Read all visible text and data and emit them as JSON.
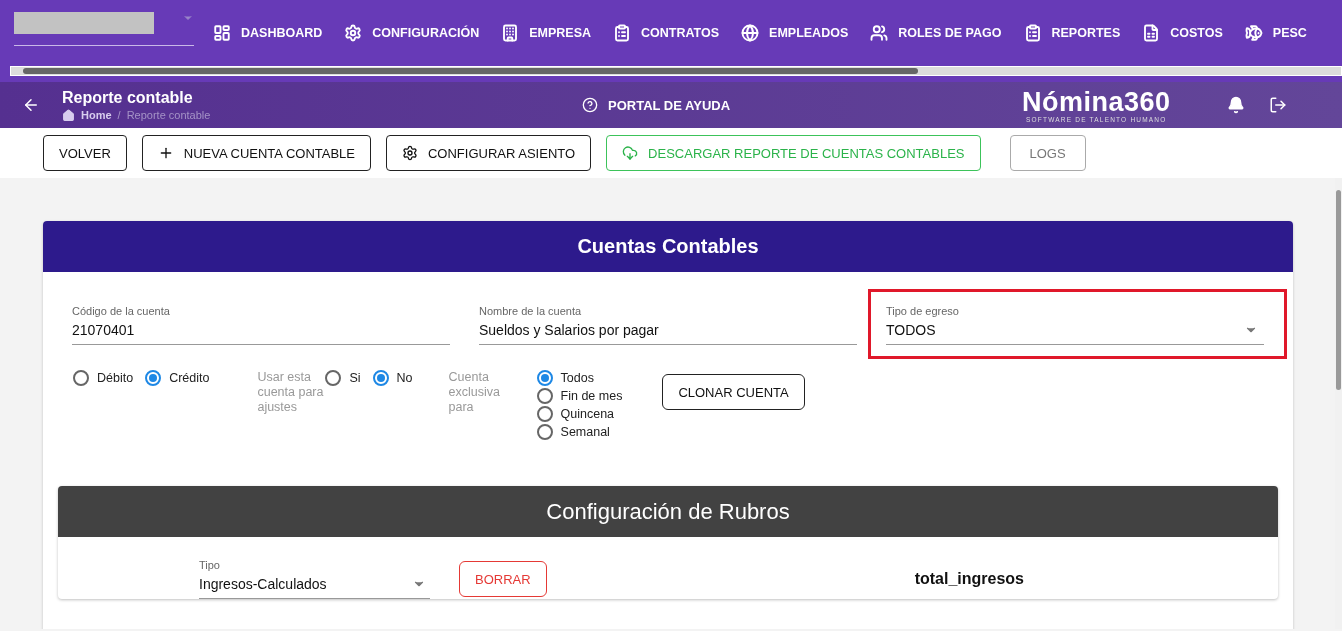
{
  "top_nav": {
    "items": [
      {
        "label": "DASHBOARD"
      },
      {
        "label": "CONFIGURACIÓN"
      },
      {
        "label": "EMPRESA"
      },
      {
        "label": "CONTRATOS"
      },
      {
        "label": "EMPLEADOS"
      },
      {
        "label": "ROLES DE PAGO"
      },
      {
        "label": "REPORTES"
      },
      {
        "label": "COSTOS"
      },
      {
        "label": "PESC"
      }
    ]
  },
  "header": {
    "title": "Reporte contable",
    "breadcrumb": [
      "Home",
      "Reporte contable"
    ],
    "breadcrumb_separator": "/",
    "help_link": "PORTAL DE AYUDA",
    "logo": "Nómina360",
    "logo_tagline": "SOFTWARE DE TALENTO HUMANO"
  },
  "toolbar": [
    {
      "label": "VOLVER",
      "kind": "plain"
    },
    {
      "label": "NUEVA CUENTA CONTABLE",
      "kind": "add"
    },
    {
      "label": "CONFIGURAR ASIENTO",
      "kind": "settings"
    },
    {
      "label": "DESCARGAR REPORTE DE CUENTAS CONTABLES",
      "kind": "download"
    },
    {
      "label": "LOGS",
      "kind": "muted"
    }
  ],
  "card": {
    "title": "Cuentas Contables",
    "fields": [
      {
        "label": "Código de la cuenta",
        "value": "21070401",
        "kind": "text"
      },
      {
        "label": "Nombre de la cuenta",
        "value": "Sueldos y Salarios  por pagar",
        "kind": "text"
      },
      {
        "label": "Tipo de egreso",
        "value": "TODOS",
        "kind": "select",
        "highlighted": true
      }
    ],
    "nature": [
      {
        "label": "Débito",
        "selected": false
      },
      {
        "label": "Crédito",
        "selected": true
      }
    ],
    "adjust_label": "Usar esta cuenta para ajustes",
    "adjust": [
      {
        "label": "Si",
        "selected": false
      },
      {
        "label": "No",
        "selected": true
      }
    ],
    "exclusive_label": "Cuenta exclusiva para",
    "exclusive": [
      {
        "label": "Todos",
        "selected": true
      },
      {
        "label": "Fin de mes",
        "selected": false
      },
      {
        "label": "Quincena",
        "selected": false
      },
      {
        "label": "Semanal",
        "selected": false
      }
    ],
    "clone_button": "CLONAR CUENTA",
    "rubros": {
      "title": "Configuración de Rubros",
      "type_label": "Tipo",
      "type_value": "Ingresos-Calculados",
      "delete_button": "BORRAR",
      "formula": "total_ingresos"
    }
  }
}
